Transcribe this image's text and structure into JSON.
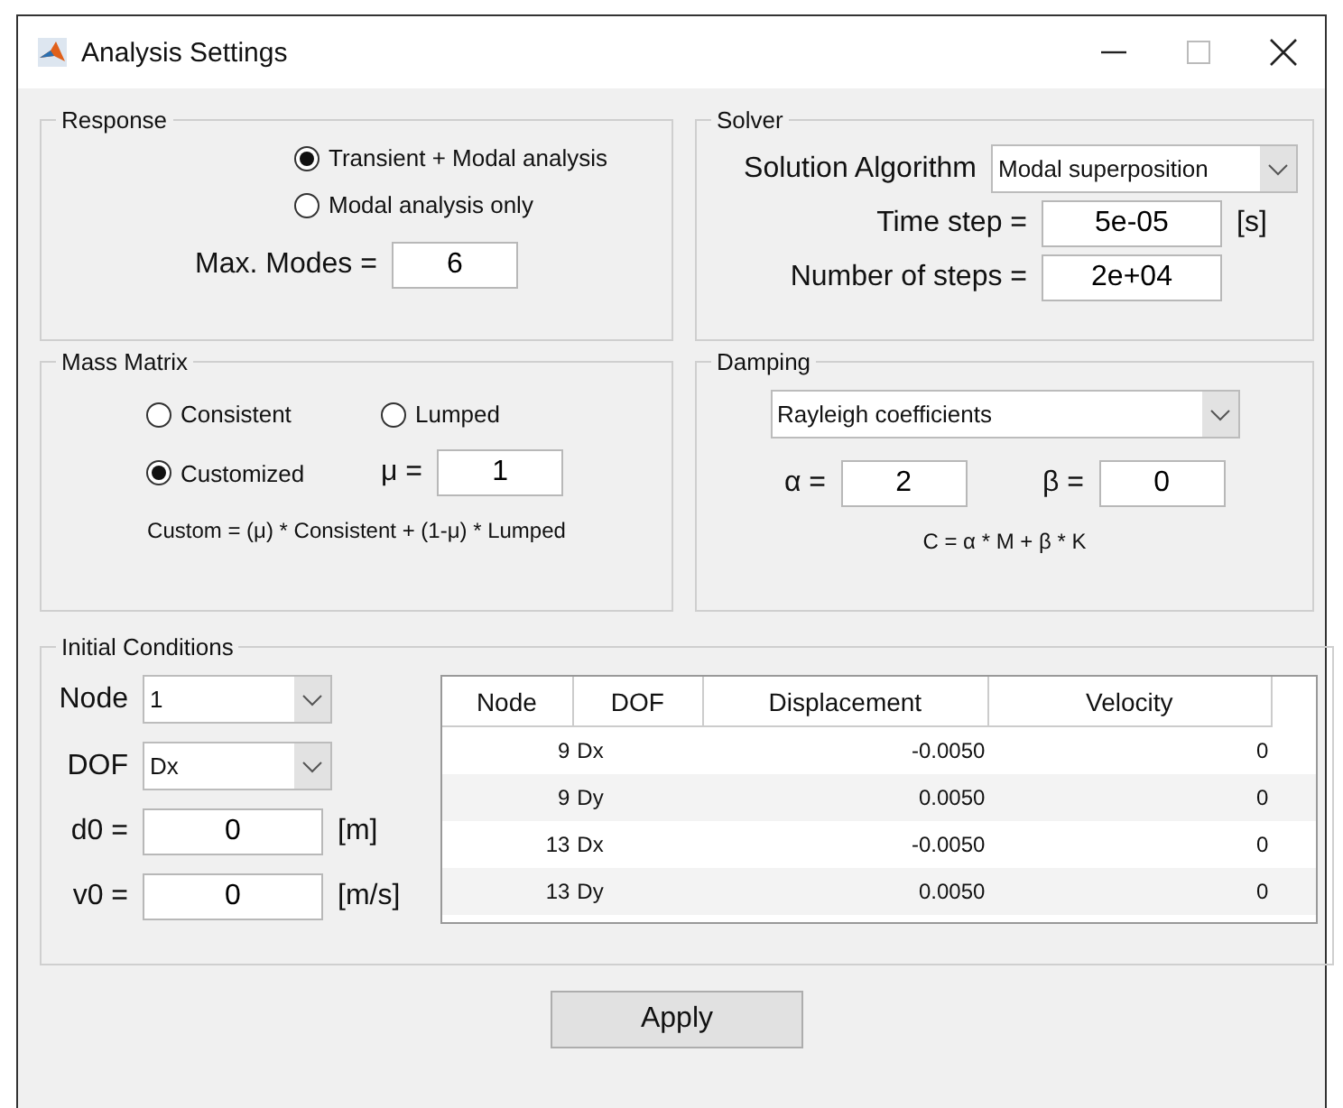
{
  "window": {
    "title": "Analysis Settings"
  },
  "response": {
    "title": "Response",
    "options": [
      {
        "label": "Transient + Modal analysis",
        "selected": true
      },
      {
        "label": "Modal analysis only",
        "selected": false
      }
    ],
    "max_modes": {
      "label": "Max. Modes =",
      "value": "6"
    }
  },
  "solver": {
    "title": "Solver",
    "algorithm": {
      "label": "Solution Algorithm",
      "value": "Modal superposition"
    },
    "time_step": {
      "label": "Time step  =",
      "value": "5e-05",
      "unit": "[s]"
    },
    "steps": {
      "label": "Number of steps =",
      "value": "2e+04"
    }
  },
  "mass_matrix": {
    "title": "Mass Matrix",
    "options": [
      {
        "label": "Consistent",
        "selected": false
      },
      {
        "label": "Lumped",
        "selected": false
      },
      {
        "label": "Customized",
        "selected": true
      }
    ],
    "mu": {
      "label": "μ =",
      "value": "1"
    },
    "formula": "Custom = (μ) * Consistent + (1-μ) * Lumped"
  },
  "damping": {
    "title": "Damping",
    "type": "Rayleigh coefficients",
    "alpha": {
      "label": "α =",
      "value": "2"
    },
    "beta": {
      "label": "β =",
      "value": "0"
    },
    "formula": "C = α * M + β * K"
  },
  "initial_conditions": {
    "title": "Initial Conditions",
    "node": {
      "label": "Node",
      "value": "1"
    },
    "dof": {
      "label": "DOF",
      "value": "Dx"
    },
    "d0": {
      "label": "d0 =",
      "value": "0",
      "unit": "[m]"
    },
    "v0": {
      "label": "v0 =",
      "value": "0",
      "unit": "[m/s]"
    },
    "table": {
      "columns": [
        "Node",
        "DOF",
        "Displacement",
        "Velocity"
      ],
      "rows": [
        [
          "9",
          "Dx",
          "-0.0050",
          "0"
        ],
        [
          "9",
          "Dy",
          "0.0050",
          "0"
        ],
        [
          "13",
          "Dx",
          "-0.0050",
          "0"
        ],
        [
          "13",
          "Dy",
          "0.0050",
          "0"
        ]
      ]
    }
  },
  "buttons": [
    "Apply"
  ]
}
